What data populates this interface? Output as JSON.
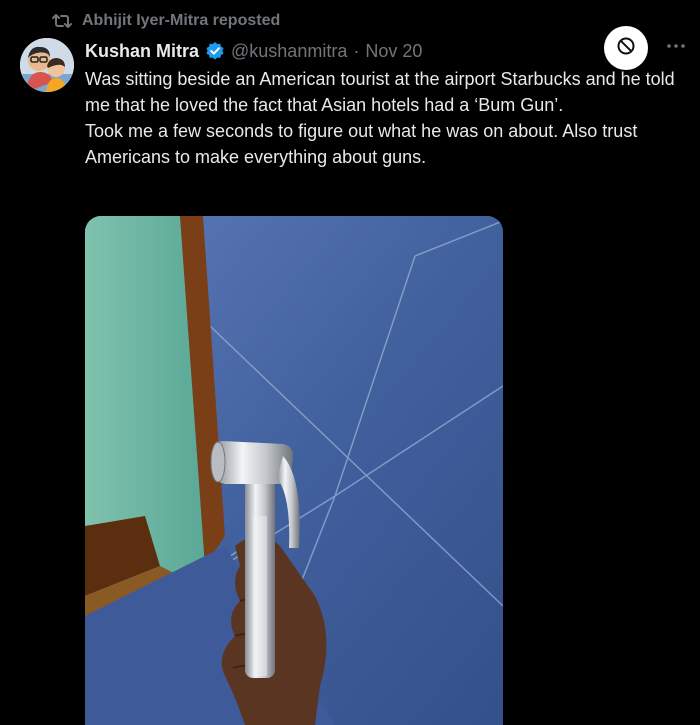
{
  "repost": {
    "icon": "repost-icon",
    "text": "Abhijit Iyer-Mitra reposted"
  },
  "author": {
    "name": "Kushan Mitra",
    "verified_icon": "verified-badge-icon",
    "handle": "@kushanmitra",
    "separator": "·",
    "date": "Nov 20"
  },
  "tweet": {
    "line1": "Was sitting beside an American tourist at the airport Starbucks and he told me that he loved the fact that Asian hotels had a ‘Bum Gun’.",
    "line2": "Took me a few seconds to figure out what he was on about. Also trust Americans to make everything about guns."
  },
  "actions": {
    "block_icon": "block-icon",
    "more_icon": "more-options-icon"
  },
  "colors": {
    "background": "#000000",
    "text": "#e7e9ea",
    "muted": "#71767b",
    "verified": "#1d9bf0",
    "tile_blue": "#3d5a9e"
  }
}
